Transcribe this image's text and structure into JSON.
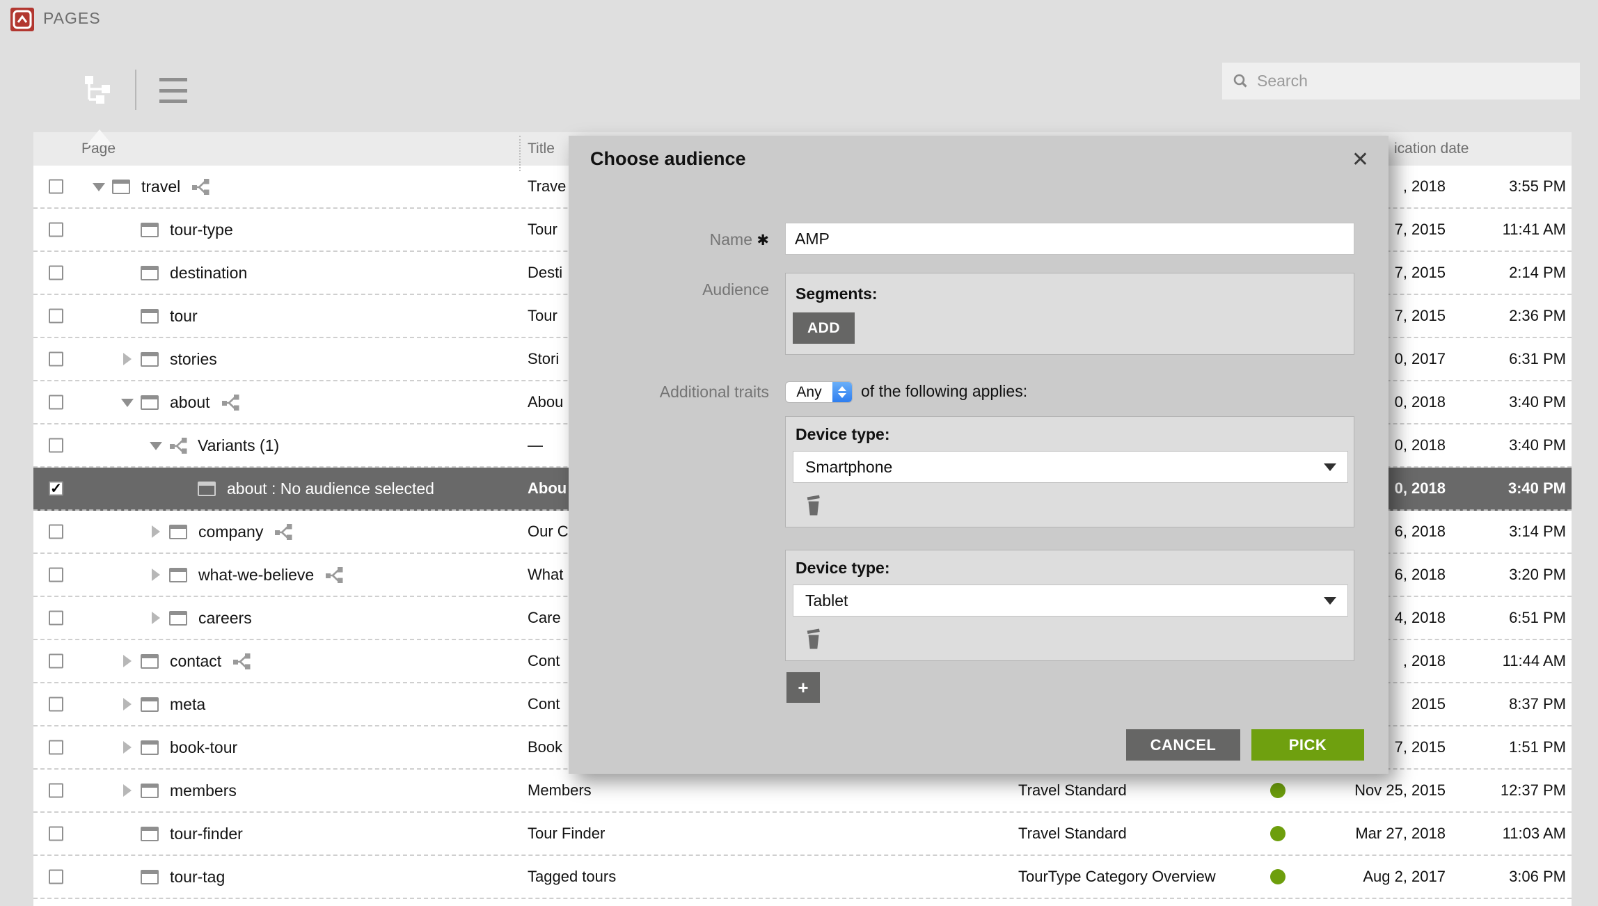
{
  "app": {
    "title": "PAGES"
  },
  "toolbar": {
    "search_placeholder": "Search"
  },
  "colors": {
    "logo_red": "#b23730",
    "pick_green": "#6fa00f",
    "status_dot_green": "#6d9e0c",
    "selected_row": "#696969",
    "select_accent_blue": "#2e7ef0"
  },
  "table": {
    "headers": {
      "page": "Page",
      "title": "Title",
      "date": "ication date"
    },
    "rows": [
      {
        "page": "travel",
        "level": 0,
        "twisty": "expanded",
        "icon": "page",
        "share": true,
        "checked": false,
        "selected": false,
        "title": "Trave",
        "template": "",
        "dot": false,
        "date": ", 2018",
        "time": "3:55 PM"
      },
      {
        "page": "tour-type",
        "level": 1,
        "twisty": "none",
        "icon": "page",
        "share": false,
        "checked": false,
        "selected": false,
        "title": "Tour",
        "template": "",
        "dot": false,
        "date": "7, 2015",
        "time": "11:41 AM"
      },
      {
        "page": "destination",
        "level": 1,
        "twisty": "none",
        "icon": "page",
        "share": false,
        "checked": false,
        "selected": false,
        "title": "Desti",
        "template": "",
        "dot": false,
        "date": "7, 2015",
        "time": "2:14 PM"
      },
      {
        "page": "tour",
        "level": 1,
        "twisty": "none",
        "icon": "page",
        "share": false,
        "checked": false,
        "selected": false,
        "title": "Tour",
        "template": "",
        "dot": false,
        "date": "7, 2015",
        "time": "2:36 PM"
      },
      {
        "page": "stories",
        "level": 1,
        "twisty": "collapsed",
        "icon": "page",
        "share": false,
        "checked": false,
        "selected": false,
        "title": "Stori",
        "template": "",
        "dot": false,
        "date": "0, 2017",
        "time": "6:31 PM"
      },
      {
        "page": "about",
        "level": 1,
        "twisty": "expanded",
        "icon": "page",
        "share": true,
        "checked": false,
        "selected": false,
        "title": "Abou",
        "template": "",
        "dot": false,
        "date": "0, 2018",
        "time": "3:40 PM"
      },
      {
        "page": "Variants (1)",
        "level": 2,
        "twisty": "expanded",
        "icon": "variants",
        "share": false,
        "checked": false,
        "selected": false,
        "title": "—",
        "template": "",
        "dot": false,
        "date": "0, 2018",
        "time": "3:40 PM"
      },
      {
        "page": "about : No audience selected",
        "level": 3,
        "twisty": "none",
        "icon": "page",
        "share": false,
        "checked": true,
        "selected": true,
        "title": "Abou",
        "template": "",
        "dot": false,
        "date": "0, 2018",
        "time": "3:40 PM"
      },
      {
        "page": "company",
        "level": 2,
        "twisty": "collapsed",
        "icon": "page",
        "share": true,
        "checked": false,
        "selected": false,
        "title": "Our C",
        "template": "",
        "dot": false,
        "date": "6, 2018",
        "time": "3:14 PM"
      },
      {
        "page": "what-we-believe",
        "level": 2,
        "twisty": "collapsed",
        "icon": "page",
        "share": true,
        "checked": false,
        "selected": false,
        "title": "What",
        "template": "",
        "dot": false,
        "date": "6, 2018",
        "time": "3:20 PM"
      },
      {
        "page": "careers",
        "level": 2,
        "twisty": "collapsed",
        "icon": "page",
        "share": false,
        "checked": false,
        "selected": false,
        "title": "Care",
        "template": "",
        "dot": false,
        "date": "4, 2018",
        "time": "6:51 PM"
      },
      {
        "page": "contact",
        "level": 1,
        "twisty": "collapsed",
        "icon": "page",
        "share": true,
        "checked": false,
        "selected": false,
        "title": "Cont",
        "template": "",
        "dot": false,
        "date": ", 2018",
        "time": "11:44 AM"
      },
      {
        "page": "meta",
        "level": 1,
        "twisty": "collapsed",
        "icon": "page",
        "share": false,
        "checked": false,
        "selected": false,
        "title": "Cont",
        "template": "",
        "dot": false,
        "date": "2015",
        "time": "8:37 PM"
      },
      {
        "page": "book-tour",
        "level": 1,
        "twisty": "collapsed",
        "icon": "page",
        "share": false,
        "checked": false,
        "selected": false,
        "title": "Book",
        "template": "",
        "dot": false,
        "date": "7, 2015",
        "time": "1:51 PM"
      },
      {
        "page": "members",
        "level": 1,
        "twisty": "collapsed",
        "icon": "page",
        "share": false,
        "checked": false,
        "selected": false,
        "title": "Members",
        "template": "Travel Standard",
        "dot": true,
        "date": "Nov 25, 2015",
        "time": "12:37 PM"
      },
      {
        "page": "tour-finder",
        "level": 1,
        "twisty": "none",
        "icon": "page",
        "share": false,
        "checked": false,
        "selected": false,
        "title": "Tour Finder",
        "template": "Travel Standard",
        "dot": true,
        "date": "Mar 27, 2018",
        "time": "11:03 AM"
      },
      {
        "page": "tour-tag",
        "level": 1,
        "twisty": "none",
        "icon": "page",
        "share": false,
        "checked": false,
        "selected": false,
        "title": "Tagged tours",
        "template": "TourType Category Overview",
        "dot": true,
        "date": "Aug 2, 2017",
        "time": "3:06 PM"
      }
    ]
  },
  "modal": {
    "title": "Choose audience",
    "close_glyph": "✕",
    "name_label": "Name",
    "required_mark": "✱",
    "name_value": "AMP",
    "audience_label": "Audience",
    "segments_heading": "Segments:",
    "add_button": "ADD",
    "traits_label": "Additional traits",
    "match_type_value": "Any",
    "traits_suffix": "of the following applies:",
    "conditions": [
      {
        "label": "Device type:",
        "value": "Smartphone"
      },
      {
        "label": "Device type:",
        "value": "Tablet"
      }
    ],
    "add_condition_button": "+",
    "cancel_button": "CANCEL",
    "pick_button": "PICK"
  }
}
